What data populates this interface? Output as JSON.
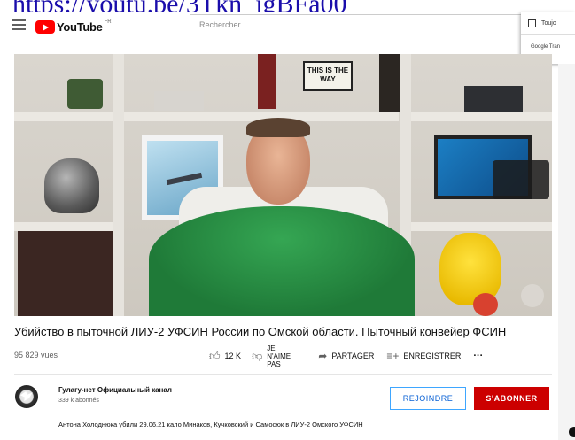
{
  "page_link": {
    "text": "https://youtu.be/3Tkn_jgBFa00"
  },
  "header": {
    "logo_text": "YouTube",
    "logo_region": "FR",
    "search_placeholder": "Rechercher"
  },
  "translate_popup": {
    "always_label": "Toujo",
    "google_label": "Google Tran"
  },
  "video": {
    "sign_text": "THIS IS THE WAY",
    "title": "Убийство в пыточной ЛИУ-2 УФСИН России по Омской области. Пыточный конвейер ФСИН",
    "views": "95 829 vues"
  },
  "actions": {
    "like_count": "12 K",
    "dislike_label": "JE N'AIME PAS",
    "share_label": "PARTAGER",
    "save_label": "ENREGISTRER",
    "more_label": "···"
  },
  "channel": {
    "name": "Гулагу-нет Официальный канал",
    "subscribers": "339 k abonnés",
    "join_label": "REJOINDRE",
    "subscribe_label": "S'ABONNER"
  },
  "description": {
    "text": "Антона Холоднюка убили 29.06.21 кало Минаков, Кучковский и Самосюк в ЛИУ-2 Омского УФСИН"
  },
  "icons": {
    "menu": "hamburger-icon",
    "like": "thumbs-up-icon",
    "dislike": "thumbs-down-icon",
    "share": "share-arrow-icon",
    "save": "playlist-add-icon"
  },
  "colors": {
    "subscribe_red": "#cc0000",
    "join_blue": "#065fd4",
    "logo_red": "#ff0000",
    "link_blue": "#1a0dab"
  }
}
